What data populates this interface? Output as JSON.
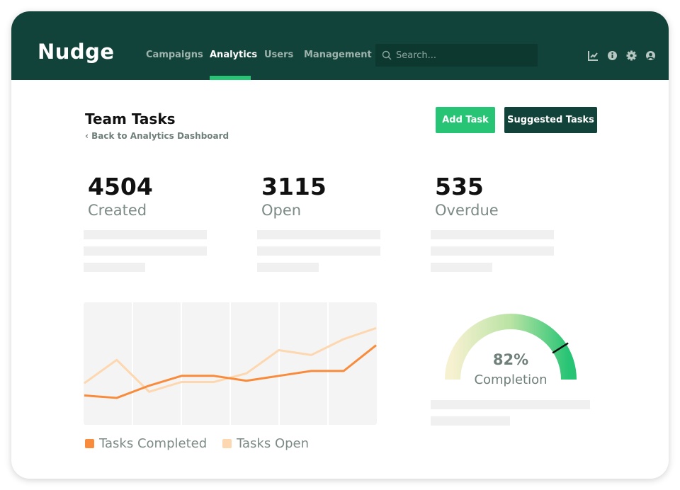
{
  "brand": "Nudge",
  "nav": {
    "items": [
      {
        "label": "Campaigns"
      },
      {
        "label": "Analytics",
        "active": true
      },
      {
        "label": "Users"
      },
      {
        "label": "Management"
      }
    ],
    "search_placeholder": "Search...",
    "icons": [
      "chart-icon",
      "info-icon",
      "gear-icon",
      "user-icon"
    ]
  },
  "page": {
    "title": "Team Tasks",
    "back_link": "Back to Analytics Dashboard",
    "add_task": "Add Task",
    "suggested_tasks": "Suggested Tasks"
  },
  "stats": [
    {
      "value": "4504",
      "label": "Created"
    },
    {
      "value": "3115",
      "label": "Open"
    },
    {
      "value": "535",
      "label": "Overdue"
    }
  ],
  "gauge": {
    "value": 82,
    "percent_label": "82%",
    "label": "Completion"
  },
  "colors": {
    "nav": "#12433a",
    "accent": "#26c474",
    "completed": "#f98c3c",
    "open": "#fdd7af"
  },
  "chart_data": {
    "type": "line",
    "x": [
      1,
      2,
      3,
      4,
      5,
      6,
      7,
      8,
      9,
      10
    ],
    "ylim": [
      0,
      100
    ],
    "series": [
      {
        "name": "Tasks Completed",
        "values": [
          24,
          22,
          32,
          40,
          40,
          36,
          40,
          44,
          44,
          65
        ]
      },
      {
        "name": "Tasks Open",
        "values": [
          34,
          53,
          27,
          35,
          35,
          42,
          61,
          57,
          70,
          79
        ]
      }
    ],
    "legend": "bottom-left",
    "grid": "vertical"
  }
}
